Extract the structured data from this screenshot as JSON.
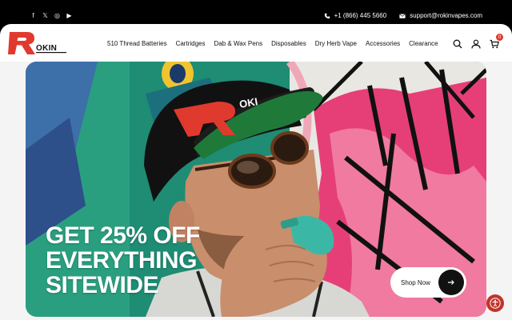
{
  "topbar": {
    "social": [
      {
        "icon": "facebook-icon",
        "glyph": "f"
      },
      {
        "icon": "x-icon",
        "glyph": "𝕏"
      },
      {
        "icon": "instagram-icon",
        "glyph": "◎"
      },
      {
        "icon": "youtube-icon",
        "glyph": "▶"
      }
    ],
    "phone": "+1 (866) 445 5660",
    "email": "support@rokinvapes.com"
  },
  "header": {
    "logo_text": "ROKIN",
    "nav": [
      "510 Thread Batteries",
      "Cartridges",
      "Dab & Wax Pens",
      "Disposables",
      "Dry Herb Vape",
      "Accessories",
      "Clearance"
    ],
    "cart_count": "0"
  },
  "hero": {
    "headline": [
      "GET 25% OFF",
      "EVERYTHING",
      "SITEWIDE"
    ],
    "cta_label": "Shop Now"
  },
  "colors": {
    "brand_red": "#e03a2e",
    "topbar": "#000000",
    "accent_teal": "#3bb8a5"
  }
}
